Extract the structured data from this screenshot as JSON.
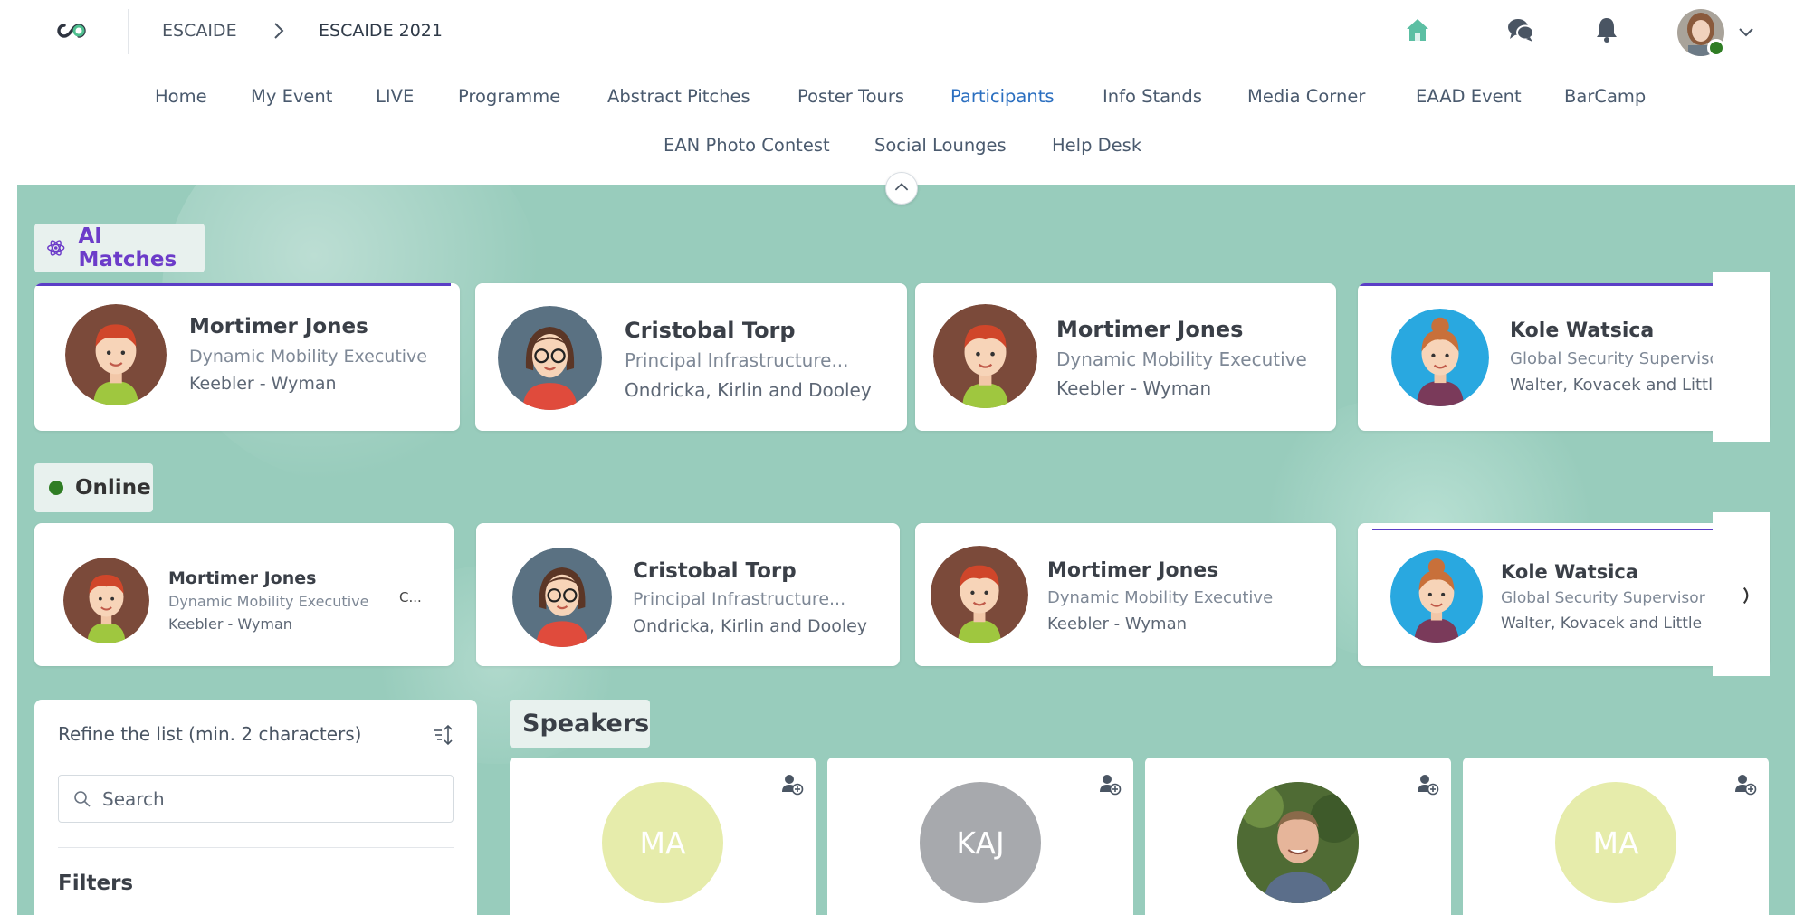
{
  "breadcrumb": {
    "root": "ESCAIDE",
    "current": "ESCAIDE 2021"
  },
  "nav": {
    "row1": [
      "Home",
      "My Event",
      "LIVE",
      "Programme",
      "Abstract Pitches",
      "Poster Tours",
      "Participants",
      "Info Stands",
      "Media Corner",
      "EAAD Event",
      "BarCamp"
    ],
    "row2": [
      "EAN Photo Contest",
      "Social Lounges",
      "Help Desk"
    ],
    "active": "Participants"
  },
  "ai_matches": {
    "label": "AI Matches",
    "cards": [
      {
        "name": "Mortimer Jones",
        "role": "Dynamic Mobility Executive",
        "company": "Keebler - Wyman"
      },
      {
        "name": "Cristobal Torp",
        "role": "Principal Infrastructure...",
        "company": "Ondricka, Kirlin and Dooley"
      },
      {
        "name": "Mortimer Jones",
        "role": "Dynamic Mobility Executive",
        "company": "Keebler - Wyman"
      },
      {
        "name": "Kole Watsica",
        "role": "Global Security Supervisor",
        "company": "Walter, Kovacek and Little"
      }
    ]
  },
  "online": {
    "label": "Online",
    "cards": [
      {
        "name": "Mortimer Jones",
        "role": "Dynamic Mobility Executive",
        "company": "Keebler - Wyman",
        "extra": "C..."
      },
      {
        "name": "Cristobal Torp",
        "role": "Principal Infrastructure...",
        "company": "Ondricka, Kirlin and Dooley"
      },
      {
        "name": "Mortimer Jones",
        "role": "Dynamic Mobility Executive",
        "company": "Keebler - Wyman"
      },
      {
        "name": "Kole Watsica",
        "role": "Global Security Supervisor",
        "company": "Walter, Kovacek and Little"
      }
    ]
  },
  "refine": {
    "label": "Refine the list (min. 2 characters)",
    "search_placeholder": "Search",
    "filters_label": "Filters"
  },
  "speakers": {
    "label": "Speakers",
    "cards": [
      {
        "initials": "MA",
        "color": "#e6ecab"
      },
      {
        "initials": "KAJ",
        "color": "#a7a9ad"
      },
      {
        "initials": "",
        "color": "#5b7a3a"
      },
      {
        "initials": "MA",
        "color": "#e6ecab"
      }
    ]
  },
  "colors": {
    "accent": "#2b6fc0",
    "ai": "#6c3cc9",
    "online": "#2f7d24",
    "background": "#98ccbc",
    "home_icon": "#5cbfa3"
  }
}
